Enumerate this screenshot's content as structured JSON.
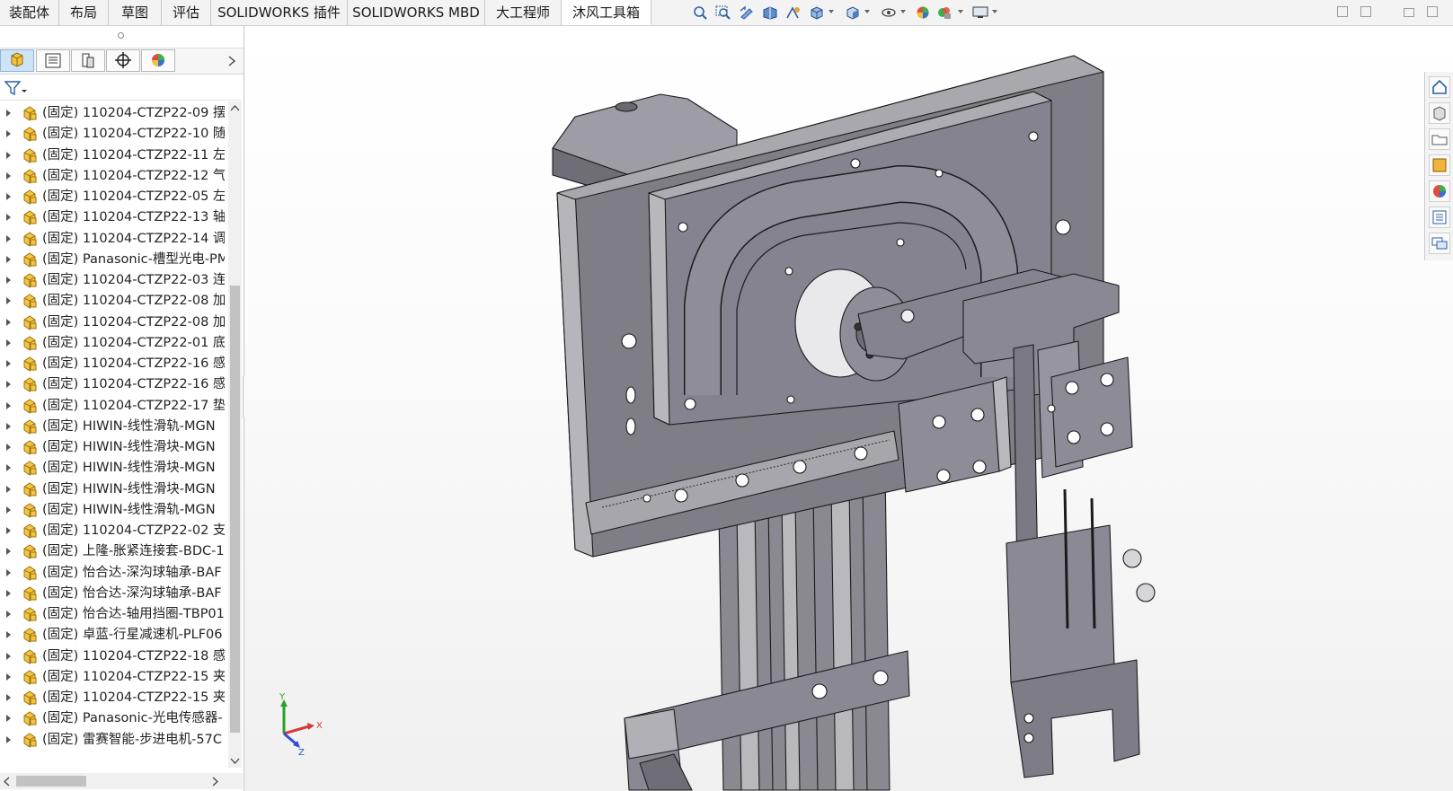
{
  "command_tabs": [
    {
      "label": "装配体",
      "active": false
    },
    {
      "label": "布局",
      "active": false
    },
    {
      "label": "草图",
      "active": false
    },
    {
      "label": "评估",
      "active": false
    },
    {
      "label": "SOLIDWORKS 插件",
      "active": false
    },
    {
      "label": "SOLIDWORKS MBD",
      "active": false
    },
    {
      "label": "大工程师",
      "active": false
    },
    {
      "label": "沐风工具箱",
      "active": true
    }
  ],
  "heads_up_icons": [
    "zoom-to-fit-icon",
    "zoom-area-icon",
    "previous-view-icon",
    "section-view-icon",
    "dynamic-annotation-icon",
    "view-orientation-icon",
    "display-style-icon",
    "hide-show-items-icon",
    "edit-appearance-icon",
    "apply-scene-icon",
    "view-settings-icon"
  ],
  "panel_tabs": [
    "featuremanager-tree-icon",
    "property-manager-icon",
    "configuration-manager-icon",
    "dimxpert-manager-icon",
    "display-manager-icon"
  ],
  "tree_items": [
    "(固定) 110204-CTZP22-09 摆",
    "(固定) 110204-CTZP22-10 随",
    "(固定) 110204-CTZP22-11 左",
    "(固定) 110204-CTZP22-12 气",
    "(固定) 110204-CTZP22-05 左",
    "(固定) 110204-CTZP22-13 轴",
    "(固定) 110204-CTZP22-14 调",
    "(固定) Panasonic-槽型光电-PM",
    "(固定) 110204-CTZP22-03 连",
    "(固定) 110204-CTZP22-08 加",
    "(固定) 110204-CTZP22-08 加",
    "(固定) 110204-CTZP22-01 底",
    "(固定) 110204-CTZP22-16 感",
    "(固定) 110204-CTZP22-16 感",
    "(固定) 110204-CTZP22-17 垫",
    "(固定) HIWIN-线性滑轨-MGN",
    "(固定) HIWIN-线性滑块-MGN",
    "(固定) HIWIN-线性滑块-MGN",
    "(固定) HIWIN-线性滑块-MGN",
    "(固定) HIWIN-线性滑轨-MGN",
    "(固定) 110204-CTZP22-02 支",
    "(固定) 上隆-胀紧连接套-BDC-1",
    "(固定) 怡合达-深沟球轴承-BAF",
    "(固定) 怡合达-深沟球轴承-BAF",
    "(固定) 怡合达-轴用挡圈-TBP01",
    "(固定) 卓蓝-行星减速机-PLF06",
    "(固定) 110204-CTZP22-18 感",
    "(固定) 110204-CTZP22-15 夹",
    "(固定) 110204-CTZP22-15 夹",
    "(固定) Panasonic-光电传感器-",
    "(固定) 雷赛智能-步进电机-57C"
  ],
  "triad": {
    "x": "X",
    "y": "Y",
    "z": "Z"
  },
  "task_pane_icons": [
    "solidworks-resources-icon",
    "design-library-icon",
    "file-explorer-icon",
    "view-palette-icon",
    "appearances-scenes-icon",
    "custom-properties-icon",
    "forum-icon"
  ],
  "colors": {
    "model_face": "#7f7d85",
    "model_edge": "#1b1b1b",
    "highlight": "#ffffff",
    "asm_icon": "#f4c542"
  }
}
